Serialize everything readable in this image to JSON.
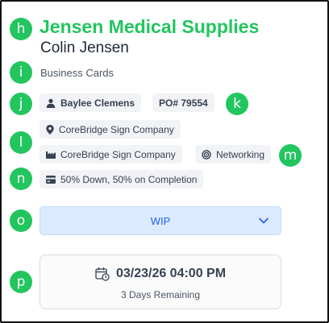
{
  "markers": {
    "h": "h",
    "i": "i",
    "j": "j",
    "k": "k",
    "l": "l",
    "m": "m",
    "n": "n",
    "o": "o",
    "p": "p"
  },
  "order": {
    "company": "Jensen Medical Supplies",
    "contact": "Colin Jensen",
    "product": "Business Cards",
    "salesperson": "Baylee Clemens",
    "po": "PO# 79554",
    "location": "CoreBridge Sign Company",
    "facility": "CoreBridge Sign Company",
    "origin": "Networking",
    "payment_terms": "50% Down, 50% on Completion",
    "status": "WIP",
    "due_date": "03/23/26 04:00 PM",
    "due_remaining": "3 Days Remaining"
  },
  "icons": {
    "salesperson": "user-icon",
    "location": "map-pin-icon",
    "facility": "factory-icon",
    "origin": "target-icon",
    "payment_terms": "credit-card-icon",
    "status": "chevron-down-icon",
    "due_date": "calendar-clock-icon"
  },
  "colors": {
    "accent": "#22c55e",
    "status_bg": "#dbeafe",
    "status_text": "#2563eb"
  }
}
